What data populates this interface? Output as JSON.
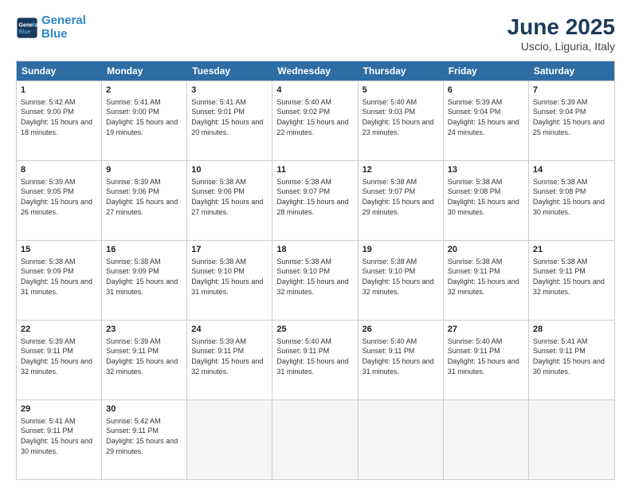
{
  "header": {
    "logo_line1": "General",
    "logo_line2": "Blue",
    "title": "June 2025",
    "subtitle": "Uscio, Liguria, Italy"
  },
  "days_of_week": [
    "Sunday",
    "Monday",
    "Tuesday",
    "Wednesday",
    "Thursday",
    "Friday",
    "Saturday"
  ],
  "weeks": [
    [
      {
        "day": 1,
        "sunrise": "5:42 AM",
        "sunset": "9:00 PM",
        "daylight": "15 hours and 18 minutes."
      },
      {
        "day": 2,
        "sunrise": "5:41 AM",
        "sunset": "9:00 PM",
        "daylight": "15 hours and 19 minutes."
      },
      {
        "day": 3,
        "sunrise": "5:41 AM",
        "sunset": "9:01 PM",
        "daylight": "15 hours and 20 minutes."
      },
      {
        "day": 4,
        "sunrise": "5:40 AM",
        "sunset": "9:02 PM",
        "daylight": "15 hours and 22 minutes."
      },
      {
        "day": 5,
        "sunrise": "5:40 AM",
        "sunset": "9:03 PM",
        "daylight": "15 hours and 23 minutes."
      },
      {
        "day": 6,
        "sunrise": "5:39 AM",
        "sunset": "9:04 PM",
        "daylight": "15 hours and 24 minutes."
      },
      {
        "day": 7,
        "sunrise": "5:39 AM",
        "sunset": "9:04 PM",
        "daylight": "15 hours and 25 minutes."
      }
    ],
    [
      {
        "day": 8,
        "sunrise": "5:39 AM",
        "sunset": "9:05 PM",
        "daylight": "15 hours and 26 minutes."
      },
      {
        "day": 9,
        "sunrise": "5:39 AM",
        "sunset": "9:06 PM",
        "daylight": "15 hours and 27 minutes."
      },
      {
        "day": 10,
        "sunrise": "5:38 AM",
        "sunset": "9:06 PM",
        "daylight": "15 hours and 27 minutes."
      },
      {
        "day": 11,
        "sunrise": "5:38 AM",
        "sunset": "9:07 PM",
        "daylight": "15 hours and 28 minutes."
      },
      {
        "day": 12,
        "sunrise": "5:38 AM",
        "sunset": "9:07 PM",
        "daylight": "15 hours and 29 minutes."
      },
      {
        "day": 13,
        "sunrise": "5:38 AM",
        "sunset": "9:08 PM",
        "daylight": "15 hours and 30 minutes."
      },
      {
        "day": 14,
        "sunrise": "5:38 AM",
        "sunset": "9:08 PM",
        "daylight": "15 hours and 30 minutes."
      }
    ],
    [
      {
        "day": 15,
        "sunrise": "5:38 AM",
        "sunset": "9:09 PM",
        "daylight": "15 hours and 31 minutes."
      },
      {
        "day": 16,
        "sunrise": "5:38 AM",
        "sunset": "9:09 PM",
        "daylight": "15 hours and 31 minutes."
      },
      {
        "day": 17,
        "sunrise": "5:38 AM",
        "sunset": "9:10 PM",
        "daylight": "15 hours and 31 minutes."
      },
      {
        "day": 18,
        "sunrise": "5:38 AM",
        "sunset": "9:10 PM",
        "daylight": "15 hours and 32 minutes."
      },
      {
        "day": 19,
        "sunrise": "5:38 AM",
        "sunset": "9:10 PM",
        "daylight": "15 hours and 32 minutes."
      },
      {
        "day": 20,
        "sunrise": "5:38 AM",
        "sunset": "9:11 PM",
        "daylight": "15 hours and 32 minutes."
      },
      {
        "day": 21,
        "sunrise": "5:38 AM",
        "sunset": "9:11 PM",
        "daylight": "15 hours and 32 minutes."
      }
    ],
    [
      {
        "day": 22,
        "sunrise": "5:39 AM",
        "sunset": "9:11 PM",
        "daylight": "15 hours and 32 minutes."
      },
      {
        "day": 23,
        "sunrise": "5:39 AM",
        "sunset": "9:11 PM",
        "daylight": "15 hours and 32 minutes."
      },
      {
        "day": 24,
        "sunrise": "5:39 AM",
        "sunset": "9:11 PM",
        "daylight": "15 hours and 32 minutes."
      },
      {
        "day": 25,
        "sunrise": "5:40 AM",
        "sunset": "9:11 PM",
        "daylight": "15 hours and 31 minutes."
      },
      {
        "day": 26,
        "sunrise": "5:40 AM",
        "sunset": "9:11 PM",
        "daylight": "15 hours and 31 minutes."
      },
      {
        "day": 27,
        "sunrise": "5:40 AM",
        "sunset": "9:11 PM",
        "daylight": "15 hours and 31 minutes."
      },
      {
        "day": 28,
        "sunrise": "5:41 AM",
        "sunset": "9:11 PM",
        "daylight": "15 hours and 30 minutes."
      }
    ],
    [
      {
        "day": 29,
        "sunrise": "5:41 AM",
        "sunset": "9:11 PM",
        "daylight": "15 hours and 30 minutes."
      },
      {
        "day": 30,
        "sunrise": "5:42 AM",
        "sunset": "9:11 PM",
        "daylight": "15 hours and 29 minutes."
      },
      null,
      null,
      null,
      null,
      null
    ]
  ]
}
